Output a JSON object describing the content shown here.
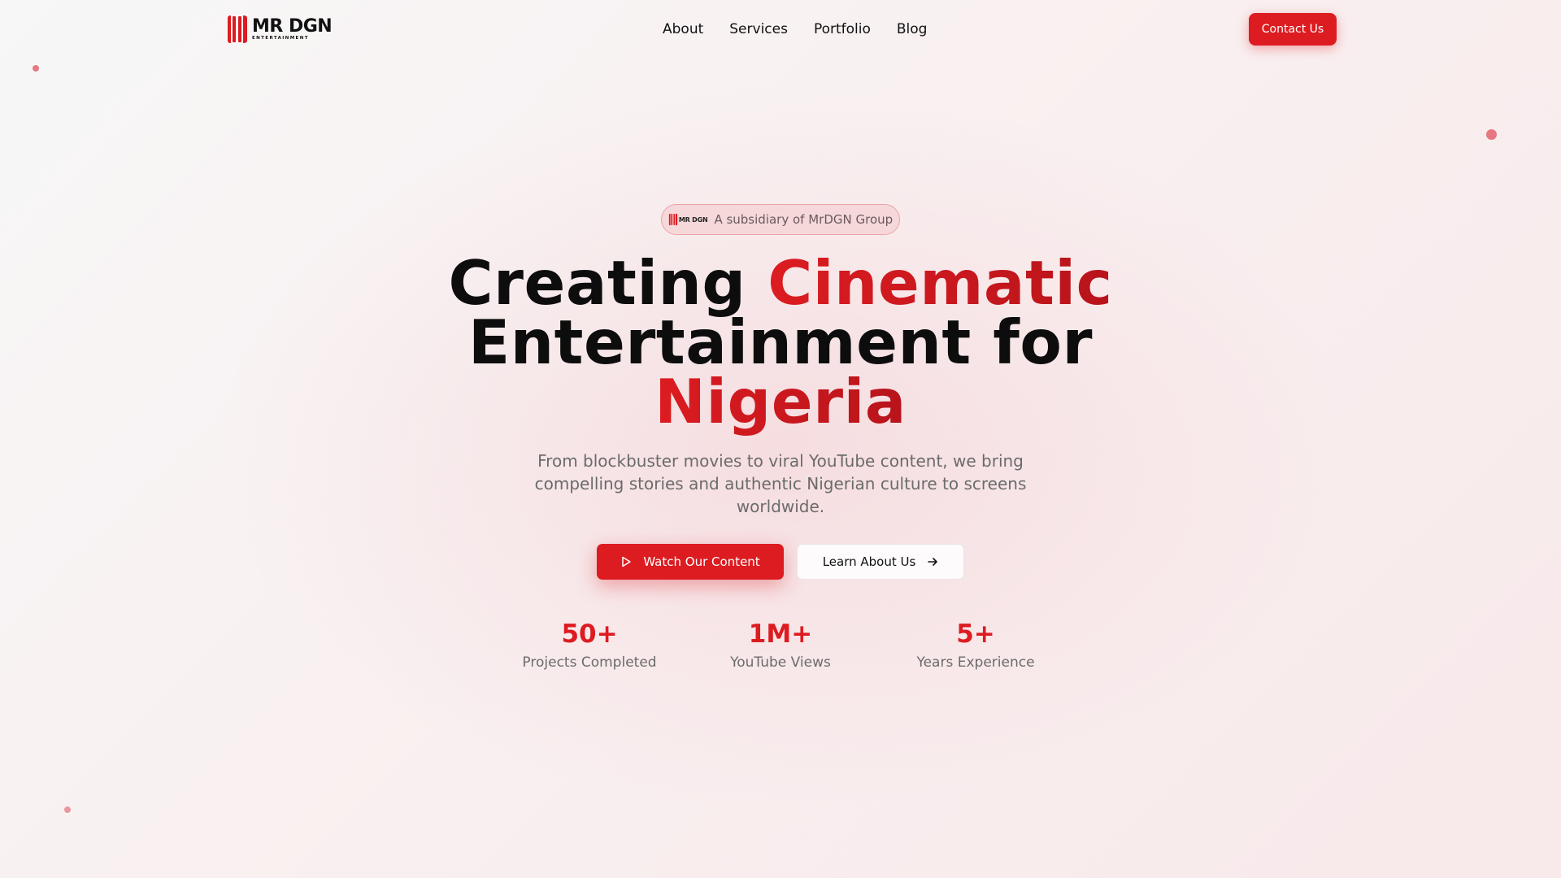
{
  "brand": {
    "name": "MR DGN",
    "tagline": "ENTERTAINMENT",
    "accent_color": "#dc1c21"
  },
  "nav": {
    "links": [
      "About",
      "Services",
      "Portfolio",
      "Blog"
    ],
    "contact_label": "Contact Us"
  },
  "hero": {
    "badge_logo_text": "MR DGN",
    "badge_text": "A subsidiary of MrDGN Group",
    "headline": {
      "part1": "Creating ",
      "accent1": "Cinematic",
      "part2": "Entertainment for",
      "accent2": "Nigeria"
    },
    "subtitle": "From blockbuster movies to viral YouTube content, we bring compelling stories and authentic Nigerian culture to screens worldwide.",
    "primary_button": {
      "label": "Watch Our Content",
      "icon": "play-icon"
    },
    "secondary_button": {
      "label": "Learn About Us",
      "icon": "arrow-right-icon"
    }
  },
  "stats": [
    {
      "value": "50+",
      "label": "Projects Completed"
    },
    {
      "value": "1M+",
      "label": "YouTube Views"
    },
    {
      "value": "5+",
      "label": "Years Experience"
    }
  ]
}
